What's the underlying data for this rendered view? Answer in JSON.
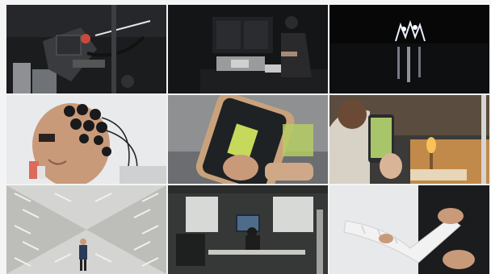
{
  "gallery": {
    "tiles": [
      {
        "subject": "robotic-apparatus-icon"
      },
      {
        "subject": "workshop-person-icon"
      },
      {
        "subject": "light-figure-icon"
      },
      {
        "subject": "eeg-headset-icon"
      },
      {
        "subject": "phone-app-icon"
      },
      {
        "subject": "phone-photo-icon"
      },
      {
        "subject": "anechoic-chamber-icon"
      },
      {
        "subject": "office-desk-icon"
      },
      {
        "subject": "arm-prosthesis-icon"
      }
    ]
  },
  "palette": {
    "background": "#f4f4f4",
    "dark": "#111111",
    "warm_light": "#f6c25a",
    "skin": "#c99a7a"
  }
}
